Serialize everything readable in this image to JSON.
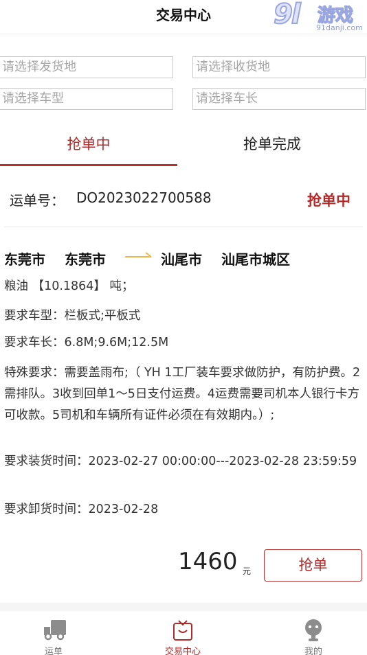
{
  "header": {
    "title": "交易中心",
    "watermark_logo": "9l",
    "watermark_name": "游戏",
    "watermark_url": "91danji.com"
  },
  "filters": {
    "ship_from_placeholder": "请选择发货地",
    "ship_to_placeholder": "请选择收货地",
    "vehicle_type_placeholder": "请选择车型",
    "vehicle_length_placeholder": "请选择车长"
  },
  "tabs": [
    {
      "label": "抢单中",
      "active": true
    },
    {
      "label": "抢单完成",
      "active": false
    }
  ],
  "order": {
    "number_label": "运单号：",
    "number": "DO2023022700588",
    "status": "抢单中",
    "route": {
      "from_city": "东莞市",
      "from_district": "东莞市",
      "to_city": "汕尾市",
      "to_district": "汕尾市城区"
    },
    "goods_line": "粮油 【10.1864】 吨；",
    "vehicle_type_line": "要求车型：栏板式;平板式",
    "vehicle_length_line": "要求车长：6.8M;9.6M;12.5M",
    "special_line": "特殊要求：需要盖雨布;（ YH 1工厂装车要求做防护，有防护费。2需排队。3收到回单1～5日支付运费。4运费需要司机本人银行卡方可收款。5司机和车辆所有证件必须在有效期内。）;",
    "load_time_line": "要求装货时间：2023-02-27 00:00:00---2023-02-28 23:59:59",
    "unload_time_line": "要求卸货时间：2023-02-28",
    "price": "1460",
    "price_unit": "元",
    "grab_button": "抢单"
  },
  "bottom_nav": [
    {
      "label": "运单",
      "icon": "truck-icon",
      "active": false
    },
    {
      "label": "交易中心",
      "icon": "shopping-bag-icon",
      "active": true
    },
    {
      "label": "我的",
      "icon": "user-icon",
      "active": false
    }
  ],
  "colors": {
    "accent": "#b22b2b",
    "route_arrow": "#e6b84a",
    "nav_inactive": "#888888"
  }
}
